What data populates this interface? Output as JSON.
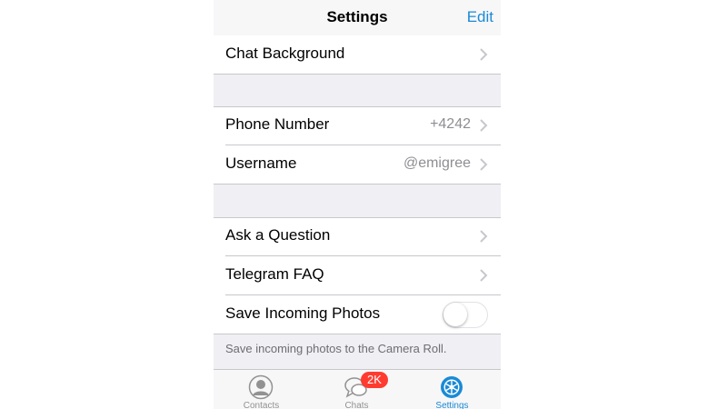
{
  "navbar": {
    "title": "Settings",
    "edit_label": "Edit"
  },
  "sections": {
    "chat_background": {
      "label": "Chat Background"
    },
    "phone_number": {
      "label": "Phone Number",
      "value": "+4242"
    },
    "username": {
      "label": "Username",
      "value": "@emigree"
    },
    "ask_question": {
      "label": "Ask a Question"
    },
    "telegram_faq": {
      "label": "Telegram FAQ"
    },
    "save_photos": {
      "label": "Save Incoming Photos",
      "enabled": false
    },
    "save_photos_footnote": "Save incoming photos to the Camera Roll."
  },
  "tabbar": {
    "tabs": [
      {
        "label": "Contacts",
        "icon": "person-icon"
      },
      {
        "label": "Chats",
        "icon": "chat-bubbles-icon",
        "badge": "2K"
      },
      {
        "label": "Settings",
        "icon": "gear-icon",
        "active": true
      }
    ]
  },
  "colors": {
    "accent": "#1a8ad6",
    "badge": "#ff3b30",
    "background": "#efeff4"
  }
}
